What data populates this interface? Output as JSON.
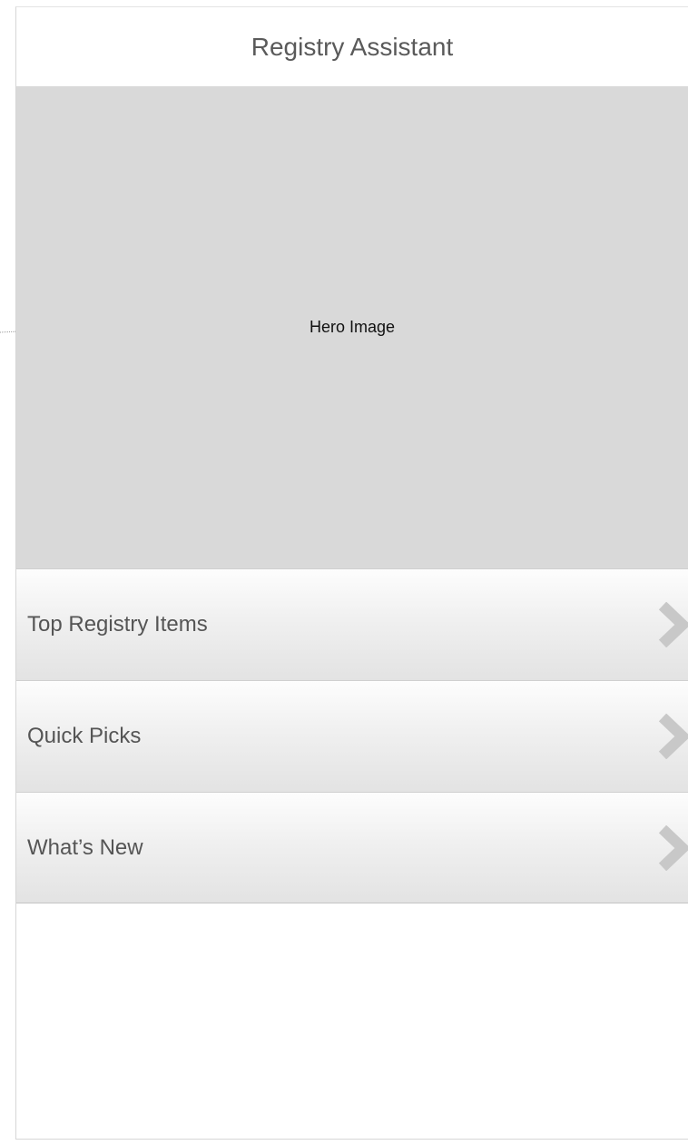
{
  "header": {
    "title": "Registry Assistant"
  },
  "hero": {
    "label": "Hero Image"
  },
  "menu": {
    "items": [
      {
        "label": "Top Registry Items",
        "icon": "chevron-right-icon"
      },
      {
        "label": "Quick Picks",
        "icon": "chevron-right-icon"
      },
      {
        "label": "What’s New",
        "icon": "chevron-right-icon"
      }
    ]
  },
  "colors": {
    "hero_background": "#d9d9d9",
    "text_primary": "#555555",
    "chevron": "#c8c8c8"
  }
}
